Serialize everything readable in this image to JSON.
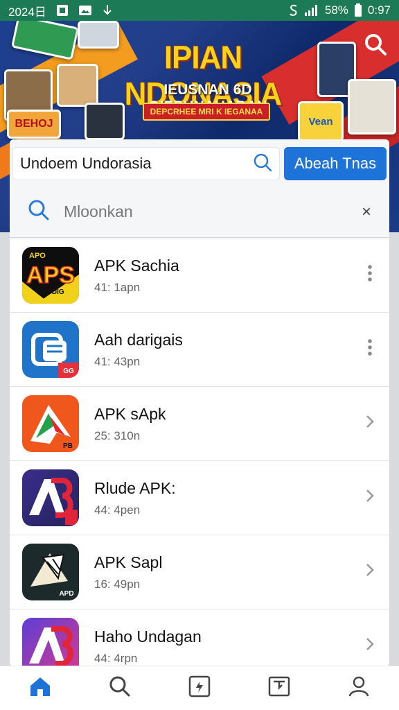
{
  "status_bar": {
    "time_left": "2024日",
    "battery": "58%",
    "clock": "0:97"
  },
  "banner": {
    "title": "IPIAN NDONASIA",
    "subtitle": "IEUSNAN 6D OIEPUNAHABAN",
    "tag": "DEPCRHEE MRI K IEGANAA",
    "badge_left": "BEHOJ",
    "badge_right": "Vean"
  },
  "search": {
    "value": "Undoem Undorasia",
    "button_label": "Abeah Tnas"
  },
  "filter": {
    "placeholder": "Mloonkan",
    "clear_symbol": "×"
  },
  "apps": [
    {
      "name": "APK Sachia",
      "time": "41: 1apn",
      "action": "more",
      "icon_label": "APS",
      "icon_top": "APO",
      "icon_bottom": "HEGDIG"
    },
    {
      "name": "Aah darigais",
      "time": "41: 43pn",
      "action": "more",
      "icon_label": "",
      "icon_badge": "GG"
    },
    {
      "name": "APK sApk",
      "time": "25: 310n",
      "action": "chevron",
      "icon_label": "",
      "icon_badge": "PB"
    },
    {
      "name": "Rlude APK:",
      "time": "44: 4pen",
      "action": "chevron",
      "icon_label": "",
      "icon_badge": ""
    },
    {
      "name": "APK Sapl",
      "time": "16: 49pn",
      "action": "chevron",
      "icon_label": "",
      "icon_badge": "APD"
    },
    {
      "name": "Haho Undagan",
      "time": "44: 4rpn",
      "action": "chevron",
      "icon_label": "",
      "icon_badge": ""
    }
  ],
  "colors": {
    "status_green": "#1d7a56",
    "accent_blue": "#1e73d8",
    "banner_yellow": "#f7d21c"
  }
}
